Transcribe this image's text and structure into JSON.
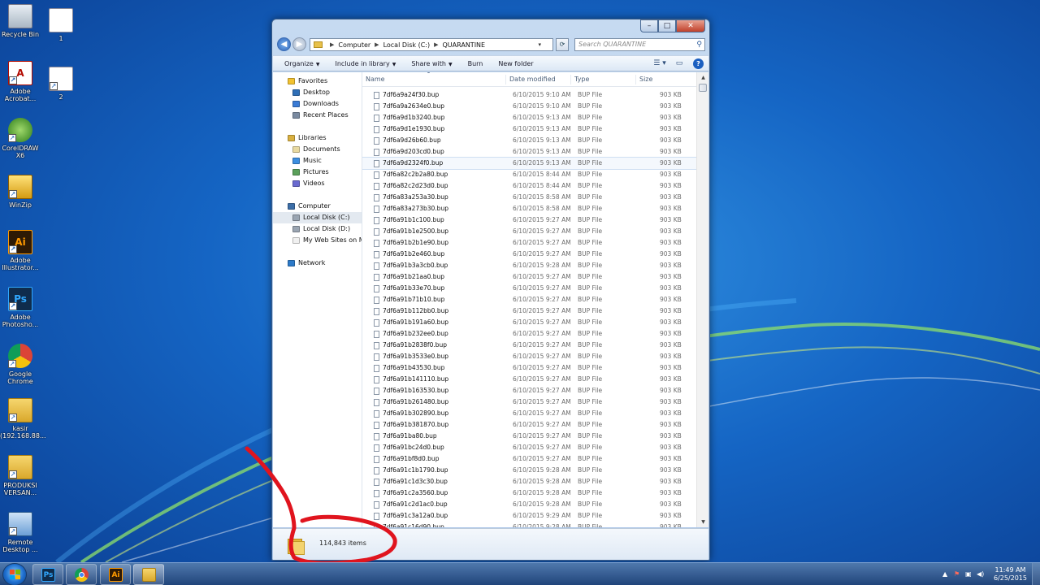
{
  "desktop": {
    "icons": [
      {
        "label": "Recycle Bin",
        "icon": "recycle-bin-icon"
      },
      {
        "label": "1",
        "icon": "image-file-icon"
      },
      {
        "label": "Adobe Acrobat...",
        "icon": "acrobat-icon"
      },
      {
        "label": "2",
        "icon": "image-file-icon"
      },
      {
        "label": "CorelDRAW X6",
        "icon": "coreldraw-icon"
      },
      {
        "label": "WinZip",
        "icon": "winzip-icon"
      },
      {
        "label": "Adobe Illustrator...",
        "icon": "illustrator-icon"
      },
      {
        "label": "Adobe Photosho...",
        "icon": "photoshop-icon"
      },
      {
        "label": "Google Chrome",
        "icon": "chrome-icon"
      },
      {
        "label": "kasir (192.168.88...",
        "icon": "network-folder-icon"
      },
      {
        "label": "PRODUKSI VERSAN...",
        "icon": "folder-icon"
      },
      {
        "label": "Remote Desktop ...",
        "icon": "remote-desktop-icon"
      }
    ]
  },
  "window": {
    "caption_buttons": {
      "minimize": "–",
      "maximize": "□",
      "close": "✕"
    },
    "address": {
      "segments": [
        "Computer",
        "Local Disk (C:)",
        "QUARANTINE"
      ]
    },
    "search": {
      "placeholder": "Search QUARANTINE"
    },
    "toolbar": {
      "organize": "Organize",
      "include_in_library": "Include in library",
      "share_with": "Share with",
      "burn": "Burn",
      "new_folder": "New folder"
    },
    "nav_pane": {
      "items": [
        {
          "label": "Favorites",
          "level": "group",
          "icon": "star-icon"
        },
        {
          "label": "Desktop",
          "level": "child",
          "icon": "desktop-icon"
        },
        {
          "label": "Downloads",
          "level": "child",
          "icon": "downloads-icon"
        },
        {
          "label": "Recent Places",
          "level": "child",
          "icon": "recent-places-icon"
        },
        {
          "label": "Libraries",
          "level": "group",
          "icon": "libraries-icon"
        },
        {
          "label": "Documents",
          "level": "child",
          "icon": "documents-icon"
        },
        {
          "label": "Music",
          "level": "child",
          "icon": "music-icon"
        },
        {
          "label": "Pictures",
          "level": "child",
          "icon": "pictures-icon"
        },
        {
          "label": "Videos",
          "level": "child",
          "icon": "videos-icon"
        },
        {
          "label": "Computer",
          "level": "group",
          "icon": "computer-icon"
        },
        {
          "label": "Local Disk (C:)",
          "level": "child",
          "icon": "drive-icon",
          "selected": true
        },
        {
          "label": "Local Disk (D:)",
          "level": "child",
          "icon": "drive-icon"
        },
        {
          "label": "My Web Sites on MSN",
          "level": "child",
          "icon": "web-folder-icon"
        },
        {
          "label": "Network",
          "level": "group",
          "icon": "network-icon"
        }
      ]
    },
    "columns": {
      "name": "Name",
      "date_modified": "Date modified",
      "type": "Type",
      "size": "Size"
    },
    "files": [
      {
        "name": "7df6a9a24f30.bup",
        "date": "6/10/2015 9:10 AM",
        "type": "BUP File",
        "size": "903 KB"
      },
      {
        "name": "7df6a9a2634e0.bup",
        "date": "6/10/2015 9:10 AM",
        "type": "BUP File",
        "size": "903 KB"
      },
      {
        "name": "7df6a9d1b3240.bup",
        "date": "6/10/2015 9:13 AM",
        "type": "BUP File",
        "size": "903 KB"
      },
      {
        "name": "7df6a9d1e1930.bup",
        "date": "6/10/2015 9:13 AM",
        "type": "BUP File",
        "size": "903 KB"
      },
      {
        "name": "7df6a9d26b60.bup",
        "date": "6/10/2015 9:13 AM",
        "type": "BUP File",
        "size": "903 KB"
      },
      {
        "name": "7df6a9d203cd0.bup",
        "date": "6/10/2015 9:13 AM",
        "type": "BUP File",
        "size": "903 KB"
      },
      {
        "name": "7df6a9d2324f0.bup",
        "date": "6/10/2015 9:13 AM",
        "type": "BUP File",
        "size": "903 KB",
        "selected": true
      },
      {
        "name": "7df6a82c2b2a80.bup",
        "date": "6/10/2015 8:44 AM",
        "type": "BUP File",
        "size": "903 KB"
      },
      {
        "name": "7df6a82c2d23d0.bup",
        "date": "6/10/2015 8:44 AM",
        "type": "BUP File",
        "size": "903 KB"
      },
      {
        "name": "7df6a83a253a30.bup",
        "date": "6/10/2015 8:58 AM",
        "type": "BUP File",
        "size": "903 KB"
      },
      {
        "name": "7df6a83a273b30.bup",
        "date": "6/10/2015 8:58 AM",
        "type": "BUP File",
        "size": "903 KB"
      },
      {
        "name": "7df6a91b1c100.bup",
        "date": "6/10/2015 9:27 AM",
        "type": "BUP File",
        "size": "903 KB"
      },
      {
        "name": "7df6a91b1e2500.bup",
        "date": "6/10/2015 9:27 AM",
        "type": "BUP File",
        "size": "903 KB"
      },
      {
        "name": "7df6a91b2b1e90.bup",
        "date": "6/10/2015 9:27 AM",
        "type": "BUP File",
        "size": "903 KB"
      },
      {
        "name": "7df6a91b2e460.bup",
        "date": "6/10/2015 9:27 AM",
        "type": "BUP File",
        "size": "903 KB"
      },
      {
        "name": "7df6a91b3a3cb0.bup",
        "date": "6/10/2015 9:28 AM",
        "type": "BUP File",
        "size": "903 KB"
      },
      {
        "name": "7df6a91b21aa0.bup",
        "date": "6/10/2015 9:27 AM",
        "type": "BUP File",
        "size": "903 KB"
      },
      {
        "name": "7df6a91b33e70.bup",
        "date": "6/10/2015 9:27 AM",
        "type": "BUP File",
        "size": "903 KB"
      },
      {
        "name": "7df6a91b71b10.bup",
        "date": "6/10/2015 9:27 AM",
        "type": "BUP File",
        "size": "903 KB"
      },
      {
        "name": "7df6a91b112bb0.bup",
        "date": "6/10/2015 9:27 AM",
        "type": "BUP File",
        "size": "903 KB"
      },
      {
        "name": "7df6a91b191a60.bup",
        "date": "6/10/2015 9:27 AM",
        "type": "BUP File",
        "size": "903 KB"
      },
      {
        "name": "7df6a91b232ee0.bup",
        "date": "6/10/2015 9:27 AM",
        "type": "BUP File",
        "size": "903 KB"
      },
      {
        "name": "7df6a91b2838f0.bup",
        "date": "6/10/2015 9:27 AM",
        "type": "BUP File",
        "size": "903 KB"
      },
      {
        "name": "7df6a91b3533e0.bup",
        "date": "6/10/2015 9:27 AM",
        "type": "BUP File",
        "size": "903 KB"
      },
      {
        "name": "7df6a91b43530.bup",
        "date": "6/10/2015 9:27 AM",
        "type": "BUP File",
        "size": "903 KB"
      },
      {
        "name": "7df6a91b141110.bup",
        "date": "6/10/2015 9:27 AM",
        "type": "BUP File",
        "size": "903 KB"
      },
      {
        "name": "7df6a91b163530.bup",
        "date": "6/10/2015 9:27 AM",
        "type": "BUP File",
        "size": "903 KB"
      },
      {
        "name": "7df6a91b261480.bup",
        "date": "6/10/2015 9:27 AM",
        "type": "BUP File",
        "size": "903 KB"
      },
      {
        "name": "7df6a91b302890.bup",
        "date": "6/10/2015 9:27 AM",
        "type": "BUP File",
        "size": "903 KB"
      },
      {
        "name": "7df6a91b381870.bup",
        "date": "6/10/2015 9:27 AM",
        "type": "BUP File",
        "size": "903 KB"
      },
      {
        "name": "7df6a91ba80.bup",
        "date": "6/10/2015 9:27 AM",
        "type": "BUP File",
        "size": "903 KB"
      },
      {
        "name": "7df6a91bc24d0.bup",
        "date": "6/10/2015 9:27 AM",
        "type": "BUP File",
        "size": "903 KB"
      },
      {
        "name": "7df6a91bf8d0.bup",
        "date": "6/10/2015 9:27 AM",
        "type": "BUP File",
        "size": "903 KB"
      },
      {
        "name": "7df6a91c1b1790.bup",
        "date": "6/10/2015 9:28 AM",
        "type": "BUP File",
        "size": "903 KB"
      },
      {
        "name": "7df6a91c1d3c30.bup",
        "date": "6/10/2015 9:28 AM",
        "type": "BUP File",
        "size": "903 KB"
      },
      {
        "name": "7df6a91c2a3560.bup",
        "date": "6/10/2015 9:28 AM",
        "type": "BUP File",
        "size": "903 KB"
      },
      {
        "name": "7df6a91c2d1ac0.bup",
        "date": "6/10/2015 9:28 AM",
        "type": "BUP File",
        "size": "903 KB"
      },
      {
        "name": "7df6a91c3a12a0.bup",
        "date": "6/10/2015 9:29 AM",
        "type": "BUP File",
        "size": "903 KB"
      },
      {
        "name": "7df6a91c16d90.bup",
        "date": "6/10/2015 9:28 AM",
        "type": "BUP File",
        "size": "903 KB"
      }
    ],
    "status": {
      "item_count": "114,843 items"
    }
  },
  "taskbar": {
    "pinned": [
      {
        "label": "Ps",
        "icon": "photoshop-taskbar-icon"
      },
      {
        "label": "",
        "icon": "chrome-taskbar-icon"
      },
      {
        "label": "Ai",
        "icon": "illustrator-taskbar-icon"
      },
      {
        "label": "",
        "icon": "explorer-taskbar-icon"
      }
    ],
    "clock": {
      "time": "11:49 AM",
      "date": "6/25/2015"
    }
  },
  "colors": {
    "annotation": "#e0141e",
    "window_frame": "#a9c5e8",
    "taskbar": "#20447a"
  }
}
